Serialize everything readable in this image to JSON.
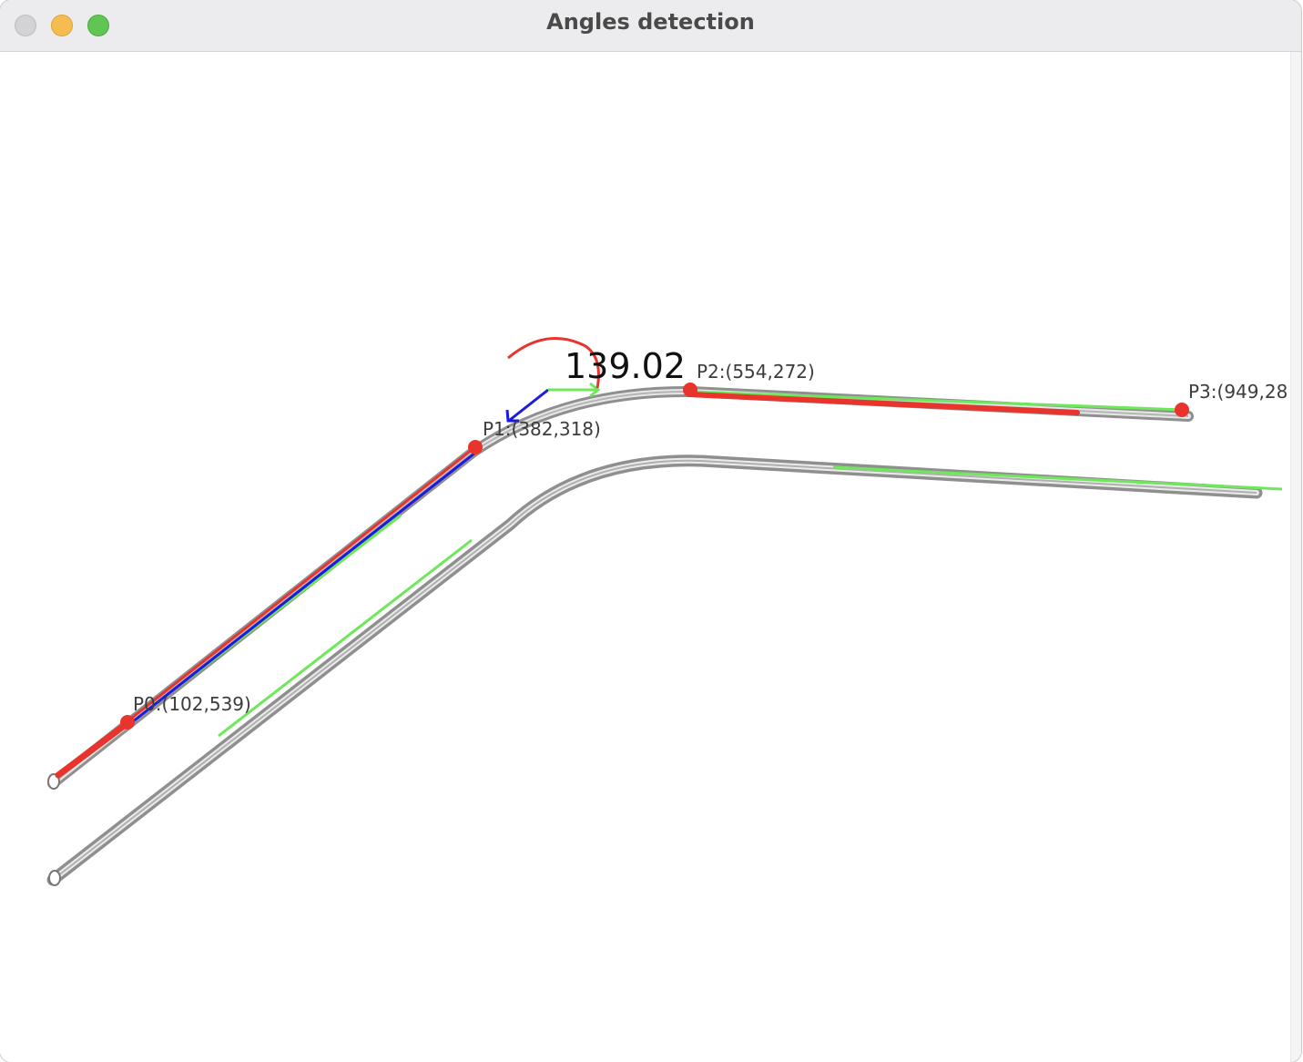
{
  "window": {
    "title": "Angles detection"
  },
  "annotations": {
    "angle_value": "139.02",
    "points": [
      {
        "name": "P0",
        "label": "P0:(102,539)"
      },
      {
        "name": "P1",
        "label": "P1:(382,318)"
      },
      {
        "name": "P2",
        "label": "P2:(554,272)"
      },
      {
        "name": "P3",
        "label": "P3:(949,28"
      }
    ]
  },
  "colors": {
    "detected_line": "#e8342c",
    "fit_line": "#6ee85a",
    "direction_vector": "#1a1ae0",
    "keypoint": "#e8342c",
    "tube": "#bdbdbd"
  }
}
